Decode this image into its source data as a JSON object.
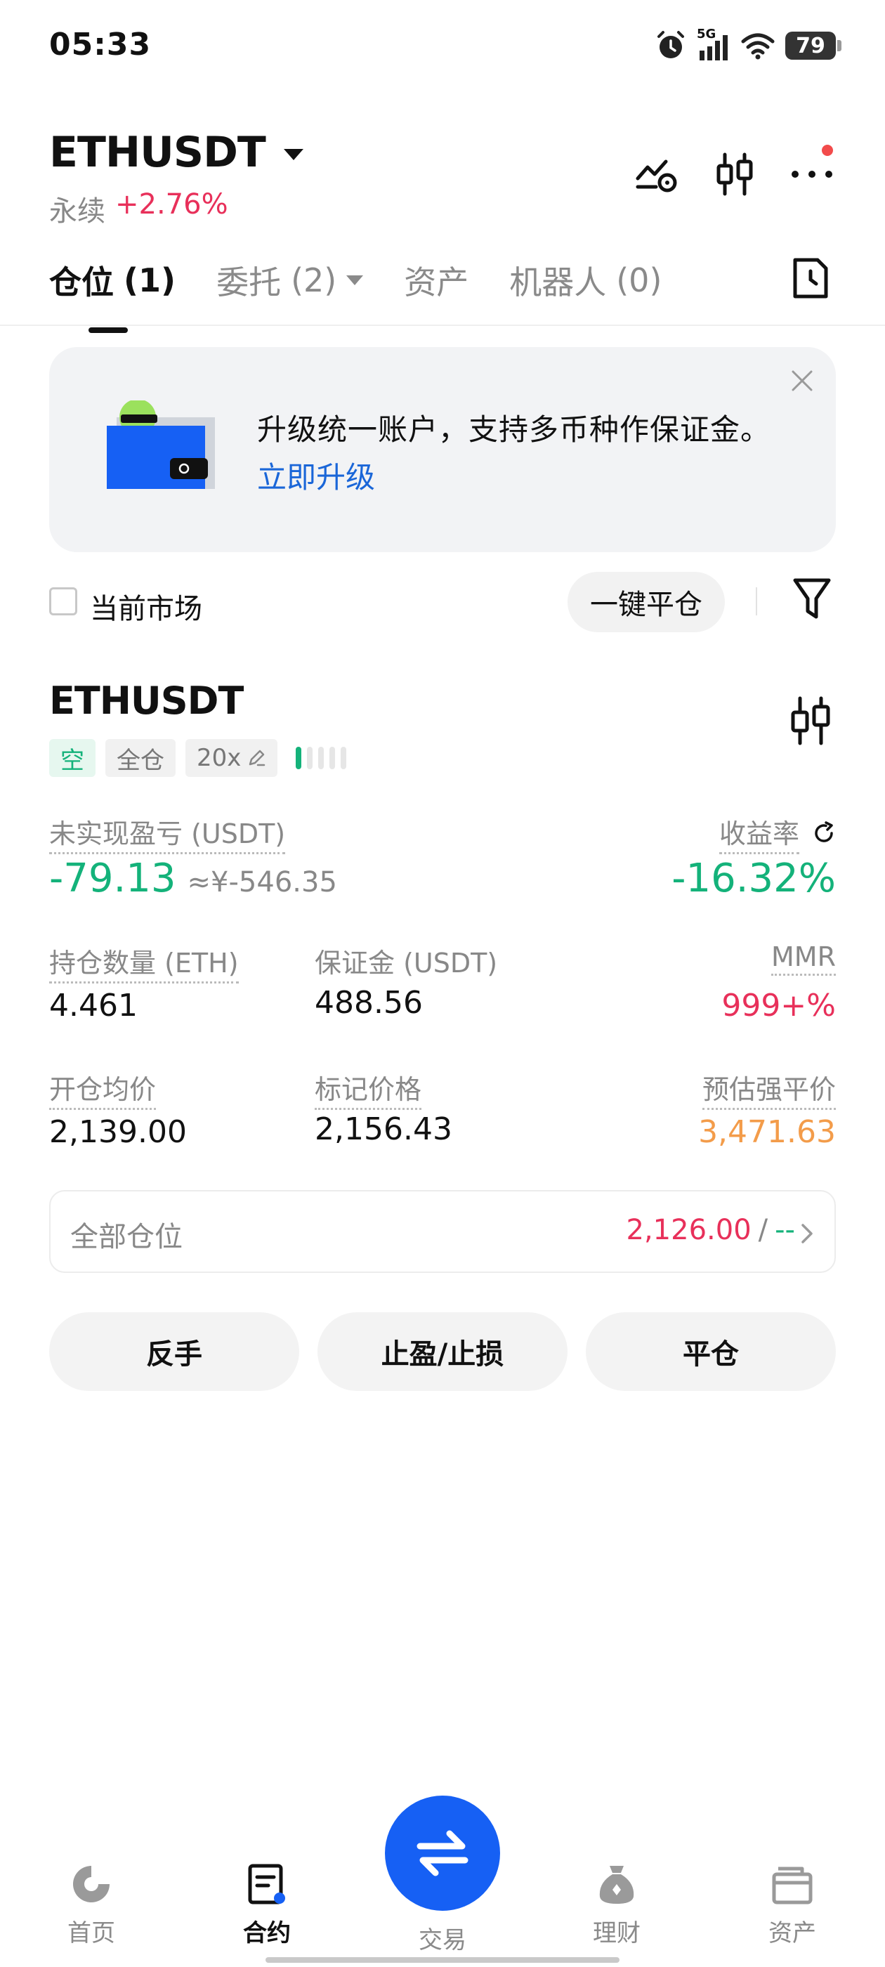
{
  "status_bar": {
    "time": "05:33",
    "network": "5G",
    "battery": "79"
  },
  "header": {
    "pair": "ETHUSDT",
    "contract_type": "永续",
    "change_pct": "+2.76%"
  },
  "tabs": [
    {
      "label": "仓位",
      "count": "(1)",
      "active": true
    },
    {
      "label": "委托",
      "count": "(2)",
      "active": false
    },
    {
      "label": "资产",
      "count": "",
      "active": false
    },
    {
      "label": "机器人",
      "count": "(0)",
      "active": false
    }
  ],
  "banner": {
    "text": "升级统一账户，支持多币种作保证金。",
    "link": "立即升级"
  },
  "filters": {
    "current_market_label": "当前市场",
    "close_all_label": "一键平仓"
  },
  "position": {
    "symbol": "ETHUSDT",
    "side_tag": "空",
    "margin_mode": "全仓",
    "leverage": "20x",
    "pnl_label": "未实现盈亏 (USDT)",
    "pnl_value": "-79.13",
    "pnl_cny": "≈¥-546.35",
    "roe_label": "收益率",
    "roe_value": "-16.32%",
    "qty_label": "持仓数量 (ETH)",
    "qty_value": "4.461",
    "margin_label": "保证金 (USDT)",
    "margin_value": "488.56",
    "mmr_label": "MMR",
    "mmr_value": "999+%",
    "entry_label": "开仓均价",
    "entry_value": "2,139.00",
    "mark_label": "标记价格",
    "mark_value": "2,156.43",
    "liq_label": "预估强平价",
    "liq_value": "3,471.63",
    "all_positions_label": "全部仓位",
    "all_positions_price": "2,126.00",
    "all_positions_sep": "/",
    "all_positions_other": "--"
  },
  "actions": {
    "reverse": "反手",
    "tpsl": "止盈/止损",
    "close": "平仓"
  },
  "bottom_nav": [
    {
      "label": "首页",
      "icon": "home-icon",
      "active": false
    },
    {
      "label": "合约",
      "icon": "contract-icon",
      "active": true
    },
    {
      "label": "交易",
      "icon": "swap-icon",
      "active": false
    },
    {
      "label": "理财",
      "icon": "earn-icon",
      "active": false
    },
    {
      "label": "资产",
      "icon": "wallet-icon",
      "active": false
    }
  ],
  "colors": {
    "profit_green": "#14b27a",
    "loss_red": "#e8305a",
    "liq_orange": "#f39c4a",
    "brand_blue": "#1660f4",
    "link_blue": "#1a66d8"
  }
}
